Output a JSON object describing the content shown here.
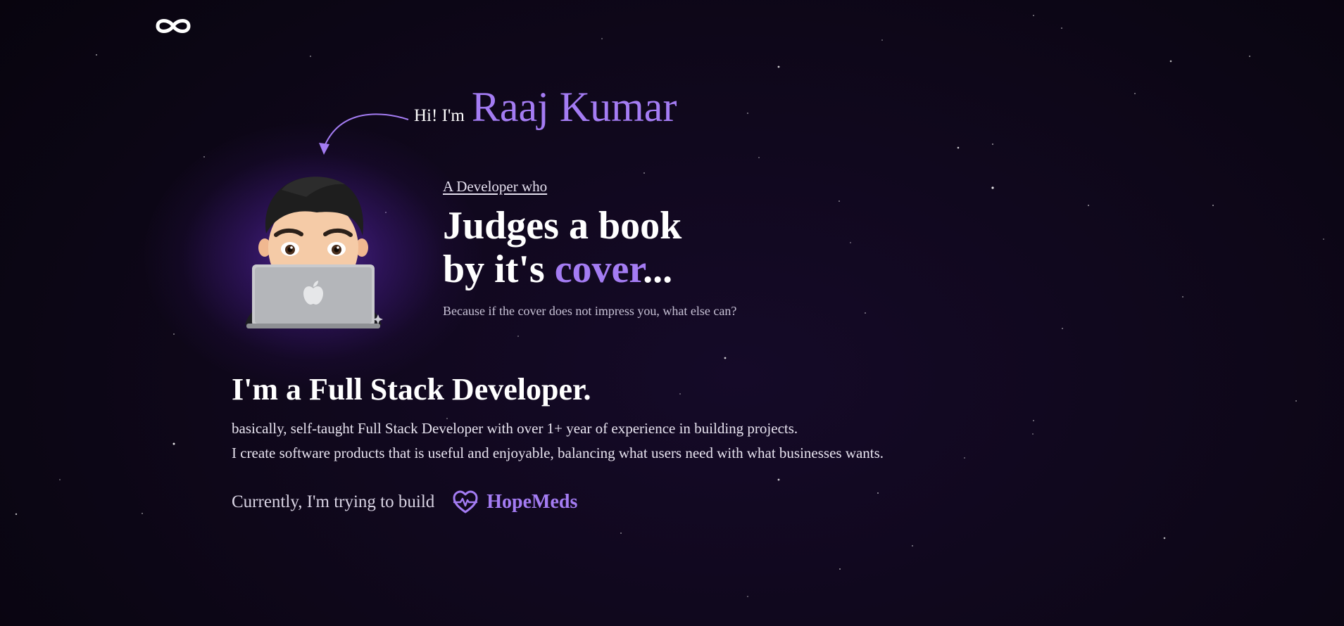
{
  "colors": {
    "background": "#0e0719",
    "accent": "#a47cf3",
    "text": "#ffffff",
    "muted": "#c8c2d6"
  },
  "header": {
    "logo_icon": "infinity-icon"
  },
  "hero": {
    "greeting_prefix": "Hi! I'm",
    "name": "Raaj Kumar",
    "arrow_icon": "curved-arrow-icon",
    "avatar": "memoji-avatar-with-laptop",
    "tagline_intro": "A Developer who",
    "headline_line1": "Judges a book",
    "headline_line2_start": "by it's ",
    "headline_line2_accent": "cover",
    "headline_line2_end": "...",
    "subline": "Because if the cover does not impress you, what else can?"
  },
  "about": {
    "title": "I'm a Full Stack Developer.",
    "line1": "basically, self-taught Full Stack Developer with over 1+ year of experience in building projects.",
    "line2": "I create software products that is useful and enjoyable, balancing what users need with what businesses wants.",
    "building_prefix": "Currently, I'm trying to build",
    "project_icon": "heart-pulse-icon",
    "project_name": "HopeMeds"
  }
}
